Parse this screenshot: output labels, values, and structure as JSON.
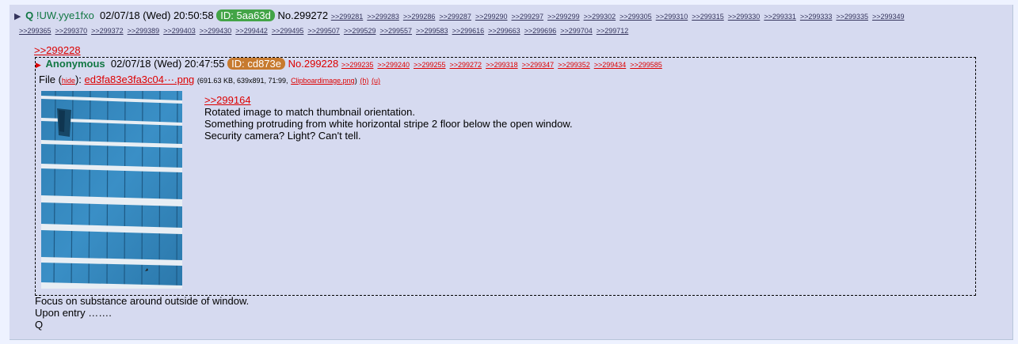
{
  "header": {
    "expand_icon": "▶",
    "name": "Q",
    "tripcode": "!UW.yye1fxo",
    "datetime": "02/07/18 (Wed) 20:50:58",
    "id_label": "ID: 5aa63d",
    "post_no": "No.299272",
    "backlinks_row1": [
      ">>299281",
      ">>299283",
      ">>299286",
      ">>299287",
      ">>299290",
      ">>299297",
      ">>299299",
      ">>299302",
      ">>299305",
      ">>299310",
      ">>299315",
      ">>299330",
      ">>299331",
      ">>299333",
      ">>299335",
      ">>299349"
    ],
    "backlinks_row2": [
      ">>299365",
      ">>299370",
      ">>299372",
      ">>299389",
      ">>299403",
      ">>299430",
      ">>299442",
      ">>299495",
      ">>299507",
      ">>299529",
      ">>299557",
      ">>299583",
      ">>299616",
      ">>299663",
      ">>299696",
      ">>299704",
      ">>299712"
    ],
    "colors": {
      "id_badge": "#43a447",
      "name": "#117743",
      "link": "#34345c"
    }
  },
  "quote_link": ">>299228",
  "quoted_post": {
    "marker_icon": "▶",
    "name": "Anonymous",
    "datetime": "02/07/18 (Wed) 20:47:55",
    "id_label": "ID: cd873e",
    "post_no": "No.299228",
    "backlinks": [
      ">>299235",
      ">>299240",
      ">>299255",
      ">>299272",
      ">>299318",
      ">>299347",
      ">>299352",
      ">>299434",
      ">>299585"
    ],
    "colors": {
      "id_badge": "#c77a2e",
      "link": "#dd0000"
    },
    "file": {
      "label": "File",
      "open_paren": "(",
      "hide_label": "hide",
      "close_paren": "):",
      "filename": "ed3fa83e3fa3c04···.png",
      "meta": "(691.63 KB, 639x891, 71:99,",
      "orig_name": "Clipboardimage.png",
      "h_label": "(h)",
      "u_label": "(u)"
    },
    "body_link": ">>299164",
    "body_lines": [
      "Rotated image to match thumbnail orientation.",
      "Something protruding from white horizontal stripe 2 floor below the open window.",
      "Security camera?  Light?  Can't tell."
    ]
  },
  "body_lines": [
    "Focus on substance around outside of window.",
    "Upon entry …….",
    "Q"
  ]
}
